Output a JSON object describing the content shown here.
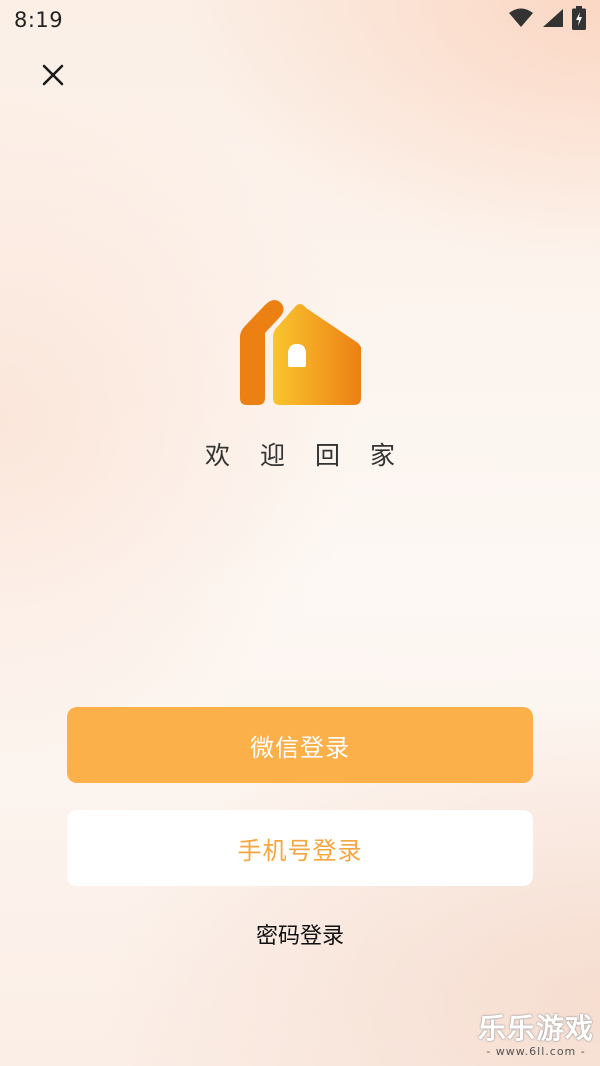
{
  "status_bar": {
    "time": "8:19",
    "icons": [
      "wifi-icon",
      "signal-icon",
      "battery-charging-icon"
    ]
  },
  "header": {
    "close_icon": "close-icon"
  },
  "logo": {
    "icon": "house-logo-icon",
    "colors": {
      "dark_orange": "#ec8012",
      "light_orange": "#f7bd2c"
    }
  },
  "welcome_text": "欢迎回家",
  "buttons": {
    "wechat_login": "微信登录",
    "phone_login": "手机号登录",
    "password_login": "密码登录"
  },
  "colors": {
    "accent": "#fcb04a",
    "accent_text": "#f6a63f"
  },
  "watermark": {
    "title": "乐乐游戏",
    "site": "- www.6ll.com -"
  }
}
